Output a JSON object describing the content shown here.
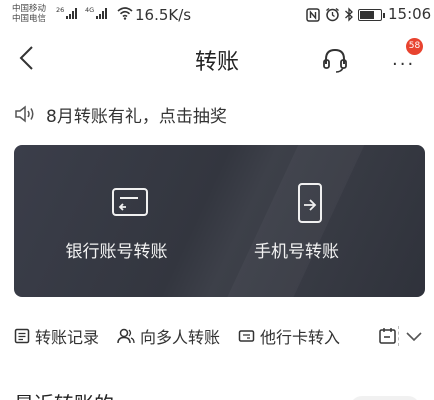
{
  "status_bar": {
    "carrier_1": "中国移动",
    "carrier_2": "中国电信",
    "signal_tag_1": "26",
    "signal_tag_2": "4G",
    "speed": "16.5K/s",
    "time": "15:06",
    "icons": [
      "nfc-icon",
      "alarm-icon",
      "bluetooth-icon",
      "battery-icon"
    ]
  },
  "nav": {
    "title": "转账",
    "badge_count": "58",
    "back_icon": "chevron-left-icon",
    "service_icon": "headset-icon",
    "more_icon": "more-icon"
  },
  "notice": {
    "text": "8月转账有礼，点击抽奖",
    "icon": "speaker-icon"
  },
  "card": {
    "items": [
      {
        "label": "银行账号转账",
        "icon": "bank-card-transfer-icon"
      },
      {
        "label": "手机号转账",
        "icon": "phone-transfer-icon"
      }
    ]
  },
  "shortcuts": [
    {
      "label": "转账记录",
      "icon": "records-icon"
    },
    {
      "label": "向多人转账",
      "icon": "multi-user-icon"
    },
    {
      "label": "他行卡转入",
      "icon": "card-in-icon"
    }
  ],
  "section": {
    "title": "最近转账的..."
  },
  "colors": {
    "card_bg": "#34373f",
    "badge": "#e8432f",
    "text": "#222222"
  }
}
